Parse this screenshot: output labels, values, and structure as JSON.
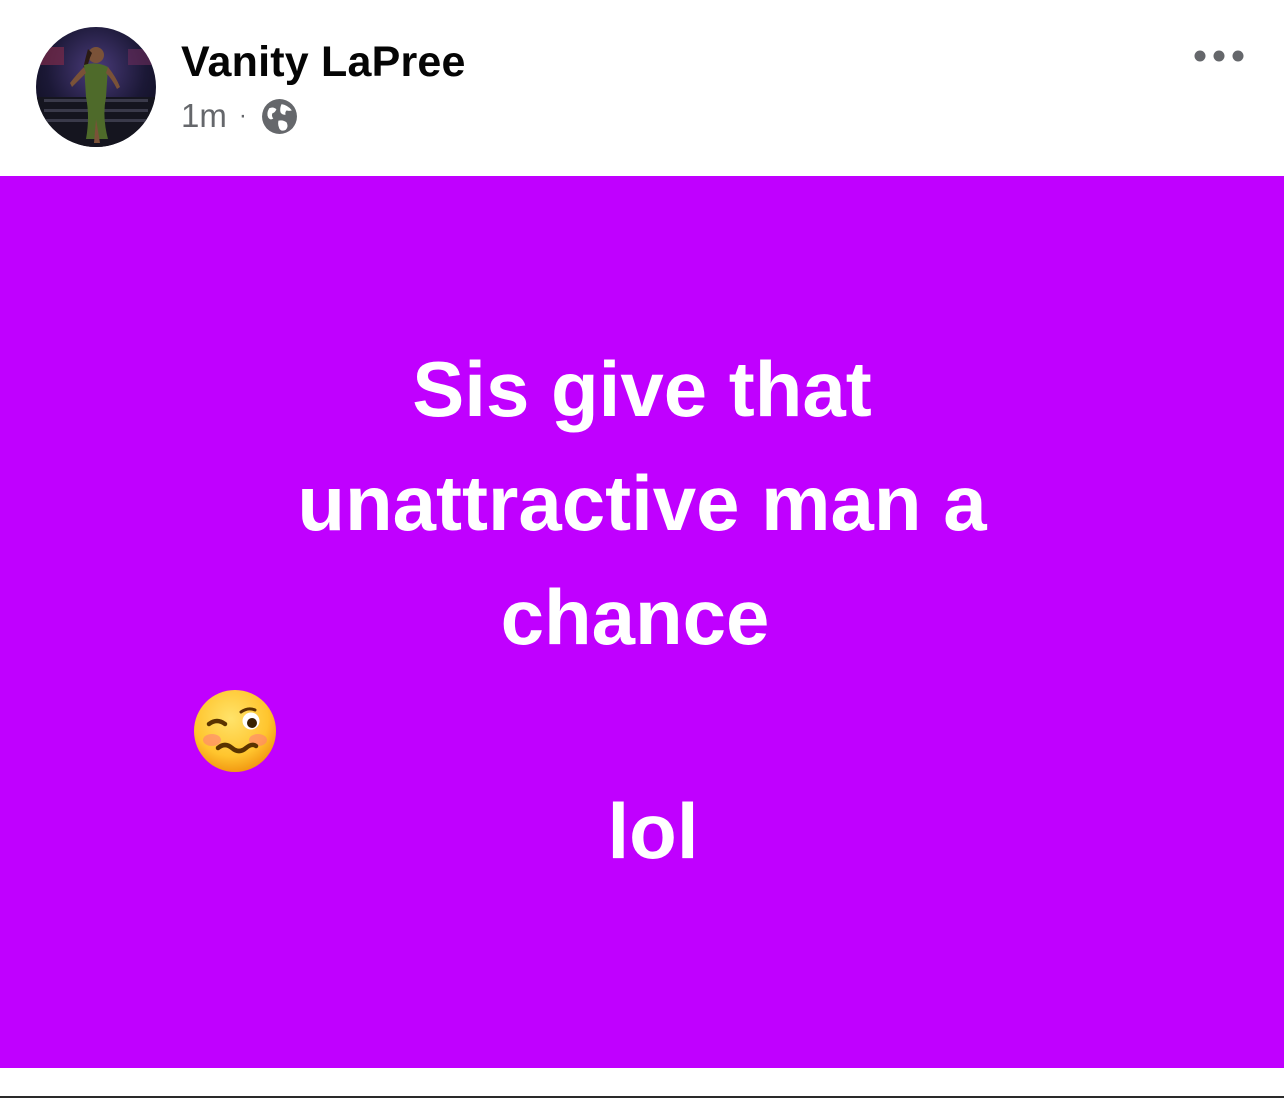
{
  "colors": {
    "post_background": "#c000ff",
    "author_text": "#050505",
    "meta_text": "#65676b",
    "post_text": "#ffffff"
  },
  "post": {
    "author": {
      "name": "Vanity LaPree"
    },
    "timestamp": "1m",
    "separator": "·",
    "audience_icon": "globe-icon",
    "menu_icon": "more-horizontal-icon",
    "body": {
      "line1": "Sis give that",
      "line2": "unattractive man a",
      "line3_before_emoji": "chance",
      "emoji": "woozy-face-icon",
      "line3_after_emoji": "lol"
    }
  }
}
